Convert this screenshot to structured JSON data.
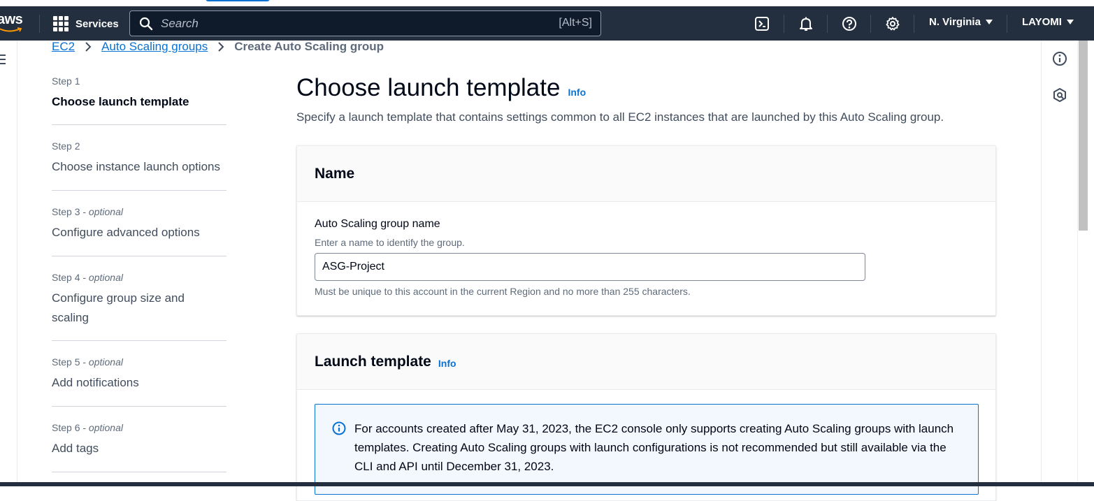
{
  "header": {
    "logo_text": "aws",
    "services_label": "Services",
    "search_placeholder": "Search",
    "search_shortcut": "[Alt+S]",
    "region_label": "N. Virginia",
    "user_label": "LAYOMI",
    "icons": [
      "cloudshell-icon",
      "bell-icon",
      "help-icon",
      "gear-icon"
    ]
  },
  "breadcrumb": {
    "items": [
      "EC2",
      "Auto Scaling groups"
    ],
    "current": "Create Auto Scaling group"
  },
  "steps": [
    {
      "number": "Step 1",
      "optional": "",
      "title": "Choose launch template",
      "active": true
    },
    {
      "number": "Step 2",
      "optional": "",
      "title": "Choose instance launch options",
      "active": false
    },
    {
      "number": "Step 3 - ",
      "optional": "optional",
      "title": "Configure advanced options",
      "active": false
    },
    {
      "number": "Step 4 - ",
      "optional": "optional",
      "title": "Configure group size and scaling",
      "active": false
    },
    {
      "number": "Step 5 - ",
      "optional": "optional",
      "title": "Add notifications",
      "active": false
    },
    {
      "number": "Step 6 - ",
      "optional": "optional",
      "title": "Add tags",
      "active": false
    }
  ],
  "main": {
    "title": "Choose launch template",
    "title_info": "Info",
    "description": "Specify a launch template that contains settings common to all EC2 instances that are launched by this Auto Scaling group."
  },
  "name_section": {
    "heading": "Name",
    "field_label": "Auto Scaling group name",
    "field_description": "Enter a name to identify the group.",
    "field_value": "ASG-Project",
    "constraint_text": "Must be unique to this account in the current Region and no more than 255 characters."
  },
  "launch_template_section": {
    "heading": "Launch template",
    "info": "Info",
    "alert_text": "For accounts created after May 31, 2023, the EC2 console only supports creating Auto Scaling groups with launch templates. Creating Auto Scaling groups with launch configurations is not recommended but still available via the CLI and API until December 31, 2023."
  },
  "colors": {
    "header_bg": "#232f3e",
    "link": "#0972d3",
    "alert_bg": "#f2f8fd",
    "text": "#000716"
  }
}
